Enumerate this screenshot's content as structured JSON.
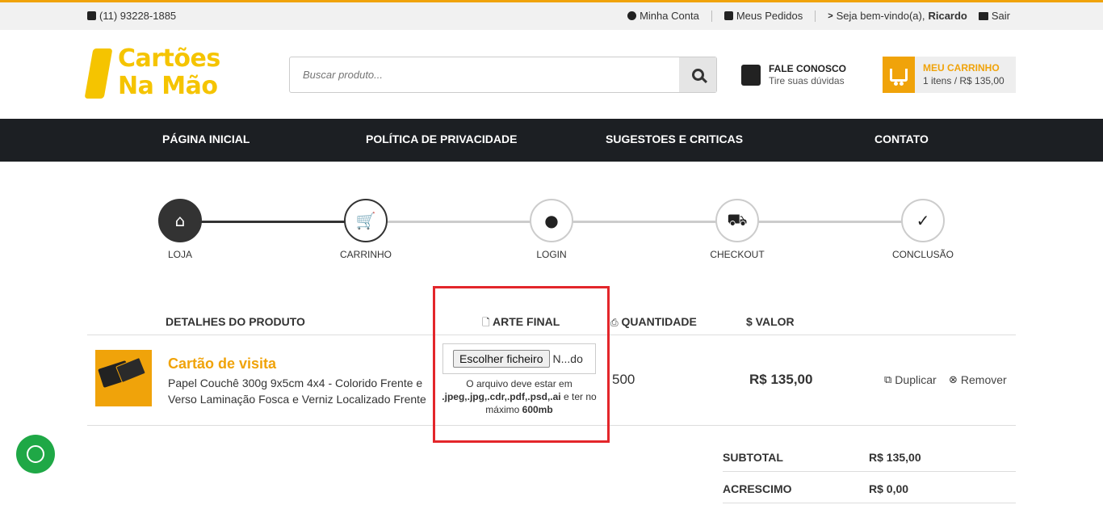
{
  "topbar": {
    "phone": "(11) 93228-1885",
    "my_account": "Minha Conta",
    "my_orders": "Meus Pedidos",
    "welcome": "Seja bem-vindo(a),",
    "user_name": "Ricardo",
    "logout": "Sair"
  },
  "brand": {
    "line1": "Cartões",
    "line2": "Na Mão",
    "color": "#f5c400"
  },
  "search": {
    "placeholder": "Buscar produto..."
  },
  "contact": {
    "title": "FALE CONOSCO",
    "subtitle": "Tire suas dúvidas"
  },
  "cart": {
    "title": "MEU CARRINHO",
    "summary": "1 itens / R$ 135,00",
    "color": "#f0a30a"
  },
  "nav": {
    "items": [
      "PÁGINA INICIAL",
      "POLÍTICA DE PRIVACIDADE",
      "SUGESTOES E CRITICAS",
      "CONTATO"
    ]
  },
  "steps": [
    {
      "label": "LOJA",
      "icon": "home-icon",
      "state": "done"
    },
    {
      "label": "CARRINHO",
      "icon": "cart-icon",
      "state": "current"
    },
    {
      "label": "LOGIN",
      "icon": "user-icon",
      "state": "todo"
    },
    {
      "label": "CHECKOUT",
      "icon": "truck-icon",
      "state": "todo"
    },
    {
      "label": "CONCLUSÃO",
      "icon": "check-icon",
      "state": "todo"
    }
  ],
  "table": {
    "headers": {
      "details": "DETALHES DO PRODUTO",
      "art": "ARTE FINAL",
      "qty": "QUANTIDADE",
      "value": "$ VALOR"
    },
    "item": {
      "name": "Cartão de visita",
      "description": "Papel Couchê 300g 9x5cm 4x4 - Colorido Frente e Verso Laminação Fosca e Verniz Localizado Frente",
      "file_button": "Escolher ficheiro",
      "file_name": "N...do",
      "note_1": "O arquivo deve estar em",
      "note_formats": ".jpeg,.jpg,.cdr,.pdf,.psd,.ai",
      "note_2": "e ter no máximo",
      "note_size": "600mb",
      "quantity": "500",
      "price": "R$ 135,00",
      "duplicate": "Duplicar",
      "remove": "Remover"
    }
  },
  "totals": {
    "subtotal_label": "SUBTOTAL",
    "subtotal_value": "R$ 135,00",
    "surcharge_label": "ACRESCIMO",
    "surcharge_value": "R$ 0,00"
  },
  "colors": {
    "accent": "#f0a30a",
    "nav_bg": "#1c1f23",
    "highlight": "#e3262b",
    "whatsapp": "#1fa846"
  }
}
